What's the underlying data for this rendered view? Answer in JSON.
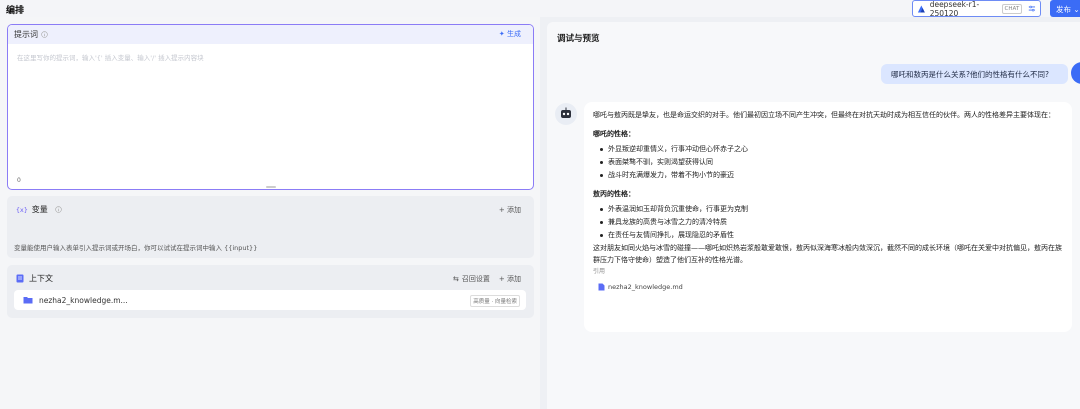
{
  "header": {
    "title": "编排",
    "model": {
      "name": "deepseek-r1-250120",
      "tag": "CHAT"
    },
    "publish_label": "发布"
  },
  "prompt": {
    "title": "提示词",
    "generate_label": "生成",
    "placeholder": "在这里写你的提示词，输入'{' 插入变量、输入'/' 插入提示内容块",
    "token_count": "0"
  },
  "variables": {
    "title": "变量",
    "add_label": "添加",
    "description": "变量能使用户输入表单引入提示词或开场白，你可以试试在提示词中输入 {{input}}"
  },
  "context": {
    "title": "上下文",
    "recall_label": "召回设置",
    "add_label": "添加",
    "file_name": "nezha2_knowledge.m...",
    "file_badge": "高质量 · 向量检索"
  },
  "preview": {
    "title": "调试与预览",
    "user_question": "哪吒和敖丙是什么关系?他们的性格有什么不同?",
    "answer_intro": "哪吒与敖丙既是挚友，也是命运交织的对手。他们最初因立场不同产生冲突，但最终在对抗天劫时成为相互信任的伙伴。两人的性格差异主要体现在：",
    "nezha_heading": "哪吒的性格：",
    "nezha_traits": [
      "外显叛逆却重情义，行事冲动但心怀赤子之心",
      "表面桀骜不驯，实则渴望获得认同",
      "战斗时充满爆发力，带着不拘小节的豪迈"
    ],
    "aobing_heading": "敖丙的性格：",
    "aobing_traits": [
      "外表温润如玉却背负沉重使命，行事更为克制",
      "兼具龙族的高贵与冰雪之力的清冷特质",
      "在责任与友情间挣扎，展现隐忍的矛盾性"
    ],
    "conclusion": "这对朋友如同火焰与冰雪的碰撞——哪吒如炽热岩浆般敢爱敢恨，敖丙似深海寒冰般内敛深沉，截然不同的成长环境（哪吒在关爱中对抗偏见，敖丙在族群压力下恪守使命）塑造了他们互补的性格光谱。",
    "citation_label": "引用",
    "citation_file": "nezha2_knowledge.md"
  }
}
